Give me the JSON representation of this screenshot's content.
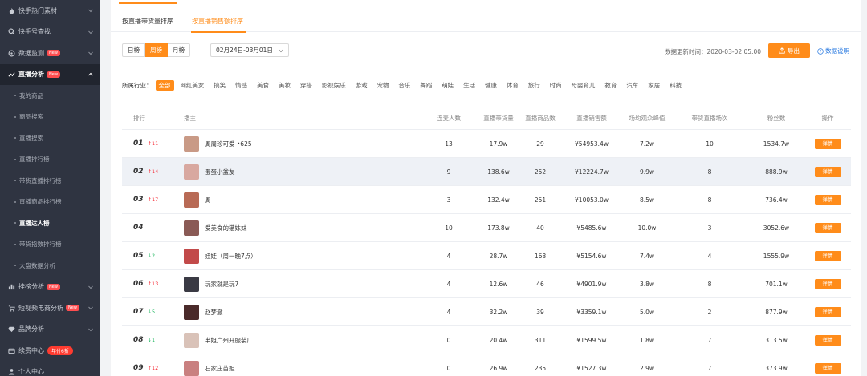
{
  "sidebar": {
    "items": [
      {
        "label": "快手热门素材",
        "icon": "flame-icon"
      },
      {
        "label": "快手号查找",
        "icon": "search-icon"
      },
      {
        "label": "数据监测",
        "icon": "monitor-icon",
        "badge": "New"
      },
      {
        "label": "直播分析",
        "icon": "trend-icon",
        "badge": "New",
        "active": true
      }
    ],
    "subitems": [
      "我的商品",
      "商品搜索",
      "直播搜索",
      "直播排行榜",
      "带货直播排行榜",
      "直播商品排行榜",
      "直播达人榜",
      "带货指数排行榜",
      "大盘数据分析"
    ],
    "current_subitem": "直播达人榜",
    "items_bottom": [
      {
        "label": "挂榜分析",
        "icon": "bar-chart-icon",
        "badge": "New"
      },
      {
        "label": "短视频电商分析",
        "icon": "cart-icon",
        "badge": "New"
      },
      {
        "label": "品牌分析",
        "icon": "diamond-icon"
      },
      {
        "label": "续费中心",
        "icon": "wallet-icon",
        "vip_badge": "年付6折"
      },
      {
        "label": "个人中心",
        "icon": "user-icon"
      }
    ]
  },
  "tabs": {
    "by_volume": "按直播带货量排序",
    "by_sales": "按直播销售额排序"
  },
  "period": {
    "options": [
      "日榜",
      "周榜",
      "月榜"
    ],
    "selected": "周榜"
  },
  "date_range": "02月24日-03月01日",
  "update_time": "数据更新时间：2020-03-02 05:00",
  "export_label": "导出",
  "data_desc_label": "数据说明",
  "industry": {
    "label": "所属行业：",
    "tags": [
      "全部",
      "网红美女",
      "搞笑",
      "情感",
      "美食",
      "美妆",
      "穿搭",
      "影视娱乐",
      "游戏",
      "宠物",
      "音乐",
      "舞蹈",
      "萌娃",
      "生活",
      "健康",
      "体育",
      "旅行",
      "时尚",
      "母婴育儿",
      "教育",
      "汽车",
      "家居",
      "科技"
    ],
    "selected": "全部"
  },
  "table": {
    "headers": [
      "排行",
      "播主",
      "连麦人数",
      "直播带货量",
      "直播商品数",
      "直播销售额",
      "场均观众峰值",
      "带货直播场次",
      "粉丝数",
      "操作"
    ],
    "rows": [
      {
        "rank": "01",
        "change": "11",
        "dir": "up",
        "name": "周周珍可爱 •625",
        "lianmai": "13",
        "volume": "17.9w",
        "products": "29",
        "sales": "¥54953.4w",
        "peak": "7.2w",
        "sessions": "10",
        "fans": "1534.7w",
        "action": "详情",
        "avatar_color": "#c99a86"
      },
      {
        "rank": "02",
        "change": "14",
        "dir": "up",
        "name": "蛋蛋小盆友",
        "lianmai": "9",
        "volume": "138.6w",
        "products": "252",
        "sales": "¥12224.7w",
        "peak": "9.9w",
        "sessions": "8",
        "fans": "888.9w",
        "action": "详情",
        "avatar_color": "#d8a8a0"
      },
      {
        "rank": "03",
        "change": "17",
        "dir": "up",
        "name": "周",
        "lianmai": "3",
        "volume": "132.4w",
        "products": "251",
        "sales": "¥10053.0w",
        "peak": "8.5w",
        "sessions": "8",
        "fans": "736.4w",
        "action": "详情",
        "avatar_color": "#b86a55"
      },
      {
        "rank": "04",
        "change": "--",
        "dir": "flat",
        "name": "爱美食的猫妹妹",
        "lianmai": "10",
        "volume": "173.8w",
        "products": "40",
        "sales": "¥5485.6w",
        "peak": "10.0w",
        "sessions": "3",
        "fans": "3052.6w",
        "action": "详情",
        "avatar_color": "#8a5a55"
      },
      {
        "rank": "05",
        "change": "2",
        "dir": "down",
        "name": "娃娃（周一晚7点）",
        "lianmai": "4",
        "volume": "28.7w",
        "products": "168",
        "sales": "¥5154.6w",
        "peak": "7.4w",
        "sessions": "4",
        "fans": "1555.9w",
        "action": "详情",
        "avatar_color": "#c24a4a"
      },
      {
        "rank": "06",
        "change": "13",
        "dir": "up",
        "name": "玩家就是玩7",
        "lianmai": "4",
        "volume": "12.6w",
        "products": "46",
        "sales": "¥4901.9w",
        "peak": "3.8w",
        "sessions": "8",
        "fans": "701.1w",
        "action": "详情",
        "avatar_color": "#3a3a44"
      },
      {
        "rank": "07",
        "change": "5",
        "dir": "down",
        "name": "赵梦澈",
        "lianmai": "4",
        "volume": "32.2w",
        "products": "39",
        "sales": "¥3359.1w",
        "peak": "5.0w",
        "sessions": "2",
        "fans": "877.9w",
        "action": "详情",
        "avatar_color": "#4a2a2a"
      },
      {
        "rank": "08",
        "change": "1",
        "dir": "down",
        "name": "半姐广州开服装厂",
        "lianmai": "0",
        "volume": "20.4w",
        "products": "311",
        "sales": "¥1599.5w",
        "peak": "1.8w",
        "sessions": "7",
        "fans": "313.5w",
        "action": "详情",
        "avatar_color": "#d9c2b8"
      },
      {
        "rank": "09",
        "change": "12",
        "dir": "up",
        "name": "石家庄苗姐",
        "lianmai": "0",
        "volume": "26.9w",
        "products": "235",
        "sales": "¥1527.3w",
        "peak": "2.9w",
        "sessions": "7",
        "fans": "373.9w",
        "action": "详情",
        "avatar_color": "#c98080"
      }
    ]
  },
  "colors": {
    "accent": "#ff8c1a",
    "sidebar_bg": "#2f3441",
    "up": "#f5222d",
    "down": "#1bb55c"
  }
}
